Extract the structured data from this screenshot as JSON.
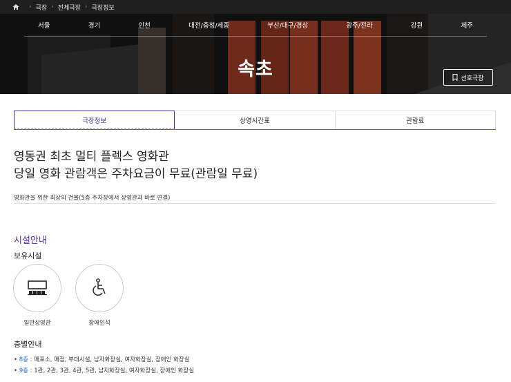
{
  "breadcrumb": [
    "극장",
    "전체극장",
    "극장정보"
  ],
  "nav": [
    "서울",
    "경기",
    "인천",
    "대전/충청/세종",
    "부산/대구/경상",
    "광주/전라",
    "강원",
    "제주"
  ],
  "theater": {
    "name": "속초",
    "favorite_label": "선호극장"
  },
  "tabs": [
    "극장정보",
    "상영시간표",
    "관람료"
  ],
  "intro": {
    "headline_1": "영동권 최초 멀티 플렉스 영화관",
    "headline_2": "당일 영화 관람객은 주차요금이 무료(관람일 무료)",
    "description": "영화관을 위한 최상의 건물(5층 주차장에서 상영관과 바로 연결)"
  },
  "facilities": {
    "title": "시설안내",
    "owned_title": "보유시설",
    "items": [
      {
        "label": "일반상영관",
        "icon": "screen-icon"
      },
      {
        "label": "장애인석",
        "icon": "wheelchair-icon"
      }
    ]
  },
  "floors": {
    "title": "층별안내",
    "items": [
      {
        "floor": "8층",
        "text": " : 매표소, 매점, 부대시설, 남자화장실, 여자화장실, 장애인 화장실"
      },
      {
        "floor": "9층",
        "text": " : 1관, 2관, 3관, 4관, 5관, 남자화장실, 여자화장실, 장애인 화장실"
      }
    ]
  }
}
